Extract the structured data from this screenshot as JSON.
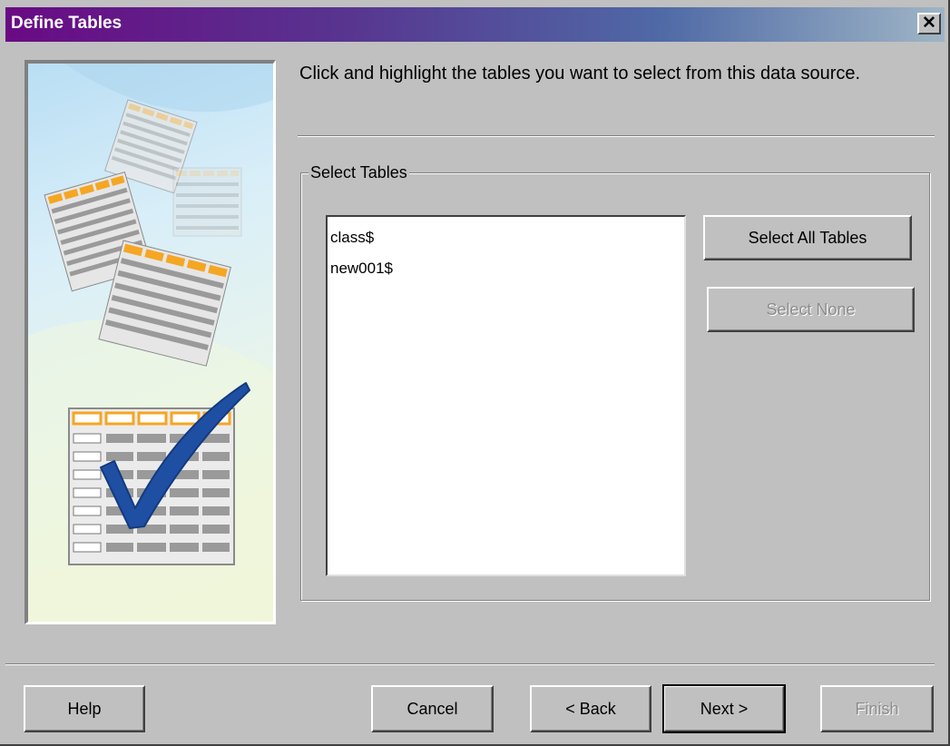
{
  "window": {
    "title": "Define Tables",
    "close_glyph": "✕"
  },
  "instruction": "Click and highlight the tables you want to select from this data source.",
  "group": {
    "legend": "Select Tables",
    "tables": [
      "class$",
      "new001$"
    ],
    "select_all_label": "Select All Tables",
    "select_none_label": "Select None"
  },
  "footer": {
    "help_label": "Help",
    "cancel_label": "Cancel",
    "back_label": "< Back",
    "next_label": "Next >",
    "finish_label": "Finish"
  },
  "colors": {
    "title_gradient_start": "#6a0a84",
    "title_gradient_end": "#9fb5c6",
    "dialog_bg": "#c0c0c0",
    "table_header": "#f5a623",
    "checkmark": "#1f4fa3"
  }
}
